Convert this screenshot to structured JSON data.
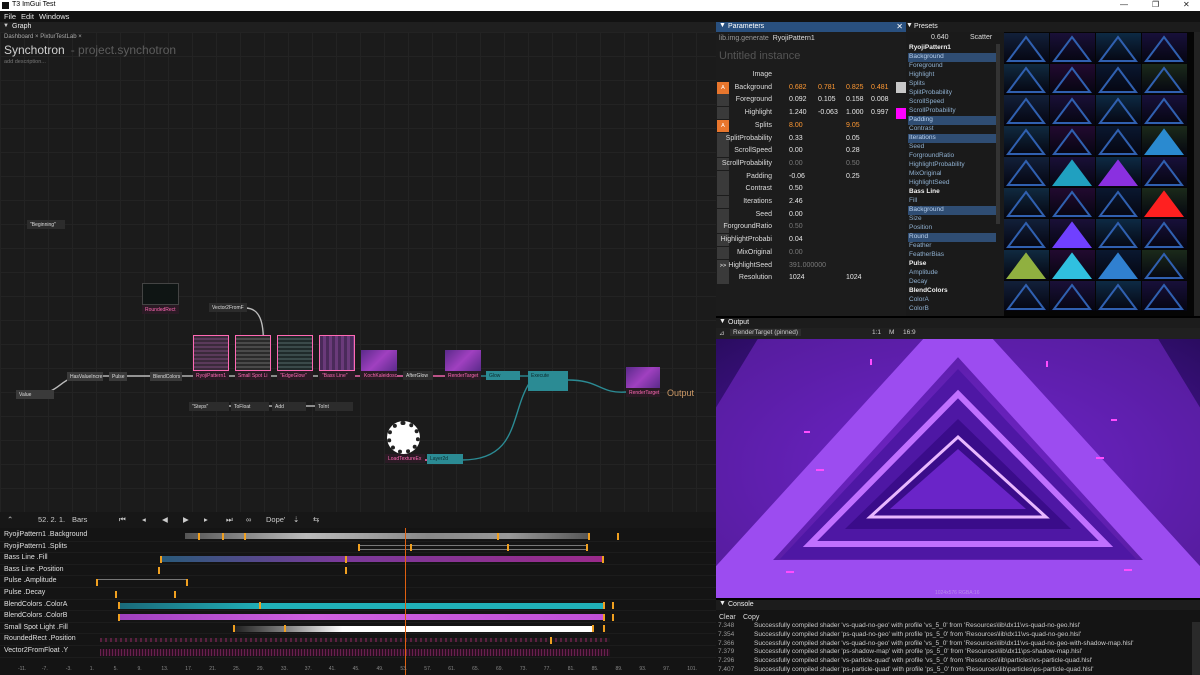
{
  "window": {
    "title": "T3 ImGui Test",
    "minimize": "—",
    "restore": "❐",
    "close": "✕"
  },
  "menu": [
    "File",
    "Edit",
    "Windows"
  ],
  "graph": {
    "tab_label": "Graph",
    "breadcrumb": "Dashboard  ×  PixturTestLab  ×",
    "project_name": "Synchotron",
    "project_sub": "- project.synchotron",
    "add_description": "add description...",
    "output_label": "Output",
    "nodes": [
      {
        "label": "\"Beginning\"",
        "kind": "dark"
      },
      {
        "label": "RoundedRect",
        "kind": "pink"
      },
      {
        "label": "Vector2FromF",
        "kind": "dark"
      },
      {
        "label": "HasValueIncre",
        "kind": "normal"
      },
      {
        "label": "Pulse",
        "kind": "normal"
      },
      {
        "label": "BlendColors",
        "kind": "normal"
      },
      {
        "label": "RyojiPattern1",
        "kind": "pink"
      },
      {
        "label": "Small Spot Li",
        "kind": "pink"
      },
      {
        "label": "\"EdgeGlow\"",
        "kind": "pink"
      },
      {
        "label": "\"Bass Line\"",
        "kind": "pink"
      },
      {
        "label": "KochKaleidosc",
        "kind": "pink"
      },
      {
        "label": "AfterGlow",
        "kind": "dark"
      },
      {
        "label": "RenderTarget",
        "kind": "pink"
      },
      {
        "label": "Glow",
        "kind": "teal"
      },
      {
        "label": "Execute",
        "kind": "teal"
      },
      {
        "label": "RenderTarget",
        "kind": "pink"
      },
      {
        "label": "Value",
        "kind": "normal"
      },
      {
        "label": "\"Steps\"",
        "kind": "dark"
      },
      {
        "label": "ToFloat",
        "kind": "dark"
      },
      {
        "label": "Add",
        "kind": "dark"
      },
      {
        "label": "ToInt",
        "kind": "dark"
      },
      {
        "label": "LoadTextureEx",
        "kind": "pink"
      },
      {
        "label": "Layer2d",
        "kind": "teal"
      }
    ]
  },
  "timeline": {
    "position": "52. 2. 1.",
    "unit": "Bars",
    "mode": "Dope'",
    "tracks": [
      "RyojiPattern1 .Background",
      "RyojiPattern1 .Splits",
      "Bass Line .Fill",
      "Bass Line .Position",
      "Pulse .Amplitude",
      "Pulse .Decay",
      "BlendColors .ColorA",
      "BlendColors .ColorB",
      "Small Spot Light .Fill",
      "RoundedRect .Position",
      "Vector2FromFloat .Y"
    ],
    "ruler": [
      "-11.",
      "-7.",
      "-3.",
      "1.",
      "5.",
      "9.",
      "13.",
      "17.",
      "21.",
      "25.",
      "29.",
      "33.",
      "37.",
      "41.",
      "45.",
      "49.",
      "53.",
      "57.",
      "61.",
      "65.",
      "69.",
      "73.",
      "77.",
      "81.",
      "85.",
      "89.",
      "93.",
      "97.",
      "101."
    ]
  },
  "parameters": {
    "tab_label": "Parameters",
    "symbol_path": "lib.img.generate",
    "symbol_name": "RyojiPattern1",
    "instance": "Untitled instance",
    "rows": [
      {
        "label": "Image",
        "values": [],
        "lane": "none"
      },
      {
        "label": "Background",
        "values": [
          "0.682",
          "0.781",
          "0.825",
          "0.481"
        ],
        "lane": "A",
        "animated": true
      },
      {
        "label": "Foreground",
        "values": [
          "0.092",
          "0.105",
          "0.158",
          "0.008"
        ],
        "lane": "none"
      },
      {
        "label": "Highlight",
        "values": [
          "1.240",
          "-0.063",
          "1.000",
          "0.997"
        ],
        "lane": "none"
      },
      {
        "label": "Splits",
        "values": [
          "8.00",
          "",
          "9.05"
        ],
        "lane": "A",
        "animated": true
      },
      {
        "label": "SplitProbability",
        "values": [
          "0.33",
          "",
          "0.05"
        ],
        "lane": "none"
      },
      {
        "label": "ScrollSpeed",
        "values": [
          "0.00",
          "",
          "0.28"
        ],
        "lane": "none"
      },
      {
        "label": "ScrollProbability",
        "values": [
          "0.00",
          "",
          "0.50"
        ],
        "lane": "none",
        "dim": true
      },
      {
        "label": "Padding",
        "values": [
          "-0.06",
          "",
          "0.25"
        ],
        "lane": "none"
      },
      {
        "label": "Contrast",
        "values": [
          "0.50"
        ],
        "lane": "none"
      },
      {
        "label": "Iterations",
        "values": [
          "2.46"
        ],
        "lane": "none"
      },
      {
        "label": "Seed",
        "values": [
          "0.00"
        ],
        "lane": "none"
      },
      {
        "label": "ForgroundRatio",
        "values": [
          "0.50"
        ],
        "lane": "none",
        "dim": true
      },
      {
        "label": "HighlightProbabi",
        "values": [
          "0.04"
        ],
        "lane": "none"
      },
      {
        "label": "MixOriginal",
        "values": [
          "0.00"
        ],
        "lane": "none",
        "dim": true
      },
      {
        "label": "HighlightSeed",
        "values": [
          "391.000000"
        ],
        "lane": ">>",
        "dim": true
      },
      {
        "label": "Resolution",
        "values": [
          "1024",
          "",
          "1024"
        ],
        "lane": "none"
      }
    ],
    "colors": {
      "background_swatch": "#c8c8c8",
      "highlight_swatch": "#ff00ff"
    }
  },
  "presets": {
    "tab_label": "Presets",
    "value": "0.640",
    "mode": "Scatter",
    "items": [
      {
        "label": "RyojiPattern1",
        "type": "group"
      },
      {
        "label": "Background",
        "type": "selected"
      },
      {
        "label": "Foreground",
        "type": "item"
      },
      {
        "label": "Highlight",
        "type": "item"
      },
      {
        "label": "Splits",
        "type": "item"
      },
      {
        "label": "SplitProbability",
        "type": "item"
      },
      {
        "label": "ScrollSpeed",
        "type": "item"
      },
      {
        "label": "ScrollProbability",
        "type": "item"
      },
      {
        "label": "Padding",
        "type": "selected"
      },
      {
        "label": "Contrast",
        "type": "item"
      },
      {
        "label": "Iterations",
        "type": "selected"
      },
      {
        "label": "Seed",
        "type": "item"
      },
      {
        "label": "ForgroundRatio",
        "type": "item"
      },
      {
        "label": "HighlightProbability",
        "type": "item"
      },
      {
        "label": "MixOriginal",
        "type": "item"
      },
      {
        "label": "HighlightSeed",
        "type": "item"
      },
      {
        "label": "Bass Line",
        "type": "group"
      },
      {
        "label": "Fill",
        "type": "item"
      },
      {
        "label": "Background",
        "type": "selected"
      },
      {
        "label": "Size",
        "type": "item"
      },
      {
        "label": "Position",
        "type": "item"
      },
      {
        "label": "Round",
        "type": "selected"
      },
      {
        "label": "Feather",
        "type": "item"
      },
      {
        "label": "FeatherBias",
        "type": "item"
      },
      {
        "label": "Pulse",
        "type": "group"
      },
      {
        "label": "Amplitude",
        "type": "item"
      },
      {
        "label": "Decay",
        "type": "item"
      },
      {
        "label": "BlendColors",
        "type": "group"
      },
      {
        "label": "ColorA",
        "type": "item"
      },
      {
        "label": "ColorB",
        "type": "item"
      }
    ]
  },
  "output": {
    "tab_label": "Output",
    "target": "RenderTarget (pinned)",
    "scale": "1:1",
    "m": "M",
    "aspect": "16:9",
    "resolution": "1024x576  RGBA:16"
  },
  "console": {
    "tab_label": "Console",
    "clear": "Clear",
    "copy": "Copy",
    "lines": [
      {
        "t": "7.348",
        "m": "Successfully compiled shader 'vs-quad-no-geo' with profile 'vs_5_0' from 'Resources\\lib\\dx11\\vs-quad-no-geo.hlsl'"
      },
      {
        "t": "7.354",
        "m": "Successfully compiled shader 'ps-quad-no-geo' with profile 'ps_5_0' from 'Resources\\lib\\dx11\\vs-quad-no-geo.hlsl'"
      },
      {
        "t": "7.366",
        "m": "Successfully compiled shader 'vs-quad-no-geo' with profile 'vs_5_0' from 'Resources\\lib\\dx11\\vs-quad-no-geo-with-shadow-map.hlsl'"
      },
      {
        "t": "7.379",
        "m": "Successfully compiled shader 'ps-shadow-map' with profile 'ps_5_0' from 'Resources\\lib\\dx11\\ps-shadow-map.hlsl'"
      },
      {
        "t": "7.296",
        "m": "Successfully compiled shader 'vs-particle-quad' with profile 'vs_5_0' from 'Resources\\lib\\particles\\vs-particle-quad.hlsl'"
      },
      {
        "t": "7.407",
        "m": "Successfully compiled shader 'ps-particle-quad' with profile 'ps_5_0' from 'Resources\\lib\\particles\\ps-particle-quad.hlsl'"
      }
    ]
  }
}
